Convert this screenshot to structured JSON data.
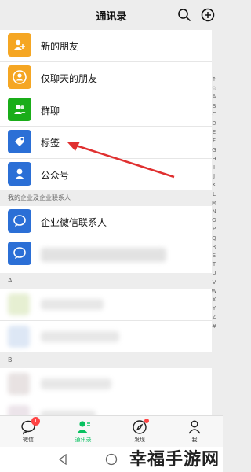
{
  "header": {
    "title": "通讯录"
  },
  "rows": [
    {
      "label": "新的朋友",
      "color": "#f5a623",
      "icon": "new-friend-icon"
    },
    {
      "label": "仅聊天的朋友",
      "color": "#f5a623",
      "icon": "chat-only-friend-icon"
    },
    {
      "label": "群聊",
      "color": "#1aad19",
      "icon": "group-chat-icon"
    },
    {
      "label": "标签",
      "color": "#2b6fd6",
      "icon": "tag-icon"
    },
    {
      "label": "公众号",
      "color": "#2b6fd6",
      "icon": "official-account-icon"
    }
  ],
  "enterprise": {
    "section_label": "我的企业及企业联系人",
    "item_label": "企业微信联系人"
  },
  "sections": {
    "a": "A",
    "b": "B"
  },
  "alphabet": [
    "↑",
    "☆",
    "A",
    "B",
    "C",
    "D",
    "E",
    "F",
    "G",
    "H",
    "I",
    "J",
    "K",
    "L",
    "M",
    "N",
    "O",
    "P",
    "Q",
    "R",
    "S",
    "T",
    "U",
    "V",
    "W",
    "X",
    "Y",
    "Z",
    "#"
  ],
  "tabs": [
    {
      "label": "微信",
      "badge": "1"
    },
    {
      "label": "通讯录"
    },
    {
      "label": "发现"
    },
    {
      "label": "我"
    }
  ],
  "colors": {
    "accent": "#07c160",
    "arrow": "#e03030"
  },
  "watermark": "幸福手游网"
}
